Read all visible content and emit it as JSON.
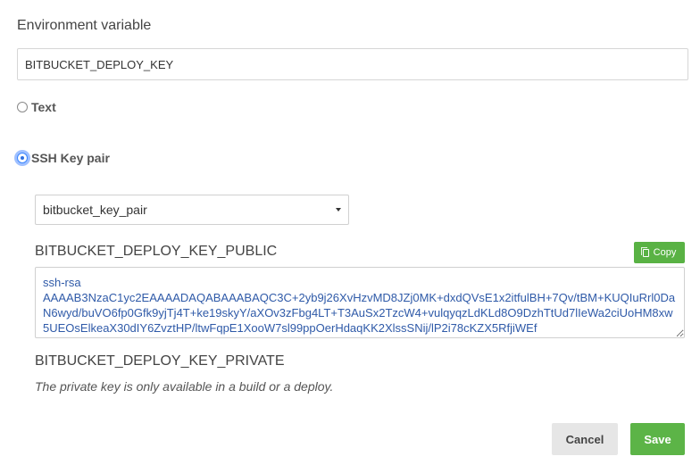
{
  "form": {
    "title": "Environment variable",
    "name_value": "BITBUCKET_DEPLOY_KEY",
    "type_options": [
      {
        "label": "Text",
        "checked": false
      },
      {
        "label": "SSH Key pair",
        "checked": true
      }
    ],
    "key_pair_select": {
      "selected": "bitbucket_key_pair"
    },
    "public_key": {
      "label": "BITBUCKET_DEPLOY_KEY_PUBLIC",
      "copy_label": "Copy",
      "value": "ssh-rsa\nAAAAB3NzaC1yc2EAAAADAQABAAABAQC3C+2yb9j26XvHzvMD8JZj0MK+dxdQVsE1x2itfulBH+7Qv/tBM+KUQIuRrl0DaN6wyd/buVO6fp0Gfk9yjTj4T+ke19skyY/aXOv3zFbg4LT+T3AuSx2TzcW4+vulqyqzLdKLd8O9DzhTtUd7lIeWa2ciUoHM8xw5UEOsElkeaX30dIY6ZvztHP/ltwFqpE1XooW7sl99ppOerHdaqKK2XlssSNij/lP2i78cKZX5RfjiWEf"
    },
    "private_key": {
      "label": "BITBUCKET_DEPLOY_KEY_PRIVATE",
      "note": "The private key is only available in a build or a deploy."
    },
    "actions": {
      "cancel_label": "Cancel",
      "save_label": "Save"
    }
  },
  "colors": {
    "primary": "#5cb447",
    "focus_ring": "#3a86ff"
  }
}
